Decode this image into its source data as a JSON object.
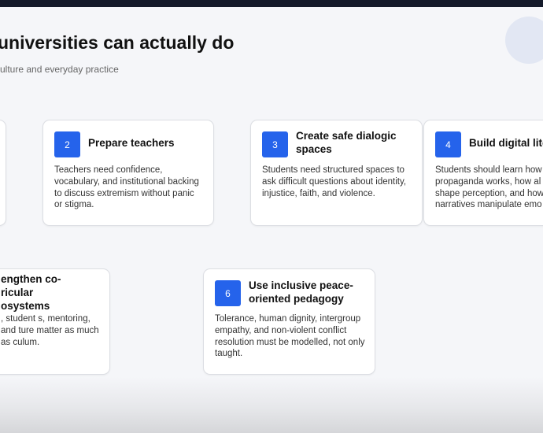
{
  "slide": {
    "title": "universities can actually do",
    "subtitle": "ulture and everyday practice"
  },
  "cards": [
    {
      "number": "2",
      "title": "Prepare teachers",
      "body": "Teachers need confidence, vocabulary, and institutional backing to discuss extremism without panic or stigma."
    },
    {
      "number": "3",
      "title": "Create safe dialogic spaces",
      "body": "Students need structured spaces to ask difficult questions about identity, injustice, faith, and violence."
    },
    {
      "number": "4",
      "title": "Build digital lite",
      "body": "Students should learn how propaganda works, how al shape perception, and how narratives manipulate emo"
    },
    {
      "number": "",
      "title": "engthen co-ricular osystems",
      "body": ", student s, mentoring, and ture matter as much as culum."
    },
    {
      "number": "6",
      "title": "Use inclusive peace-oriented pedagogy",
      "body": "Tolerance, human dignity, intergroup empathy, and non-violent conflict resolution must be modelled, not only taught."
    }
  ],
  "colors": {
    "accent": "#2563eb",
    "topbar": "#141a2a"
  }
}
